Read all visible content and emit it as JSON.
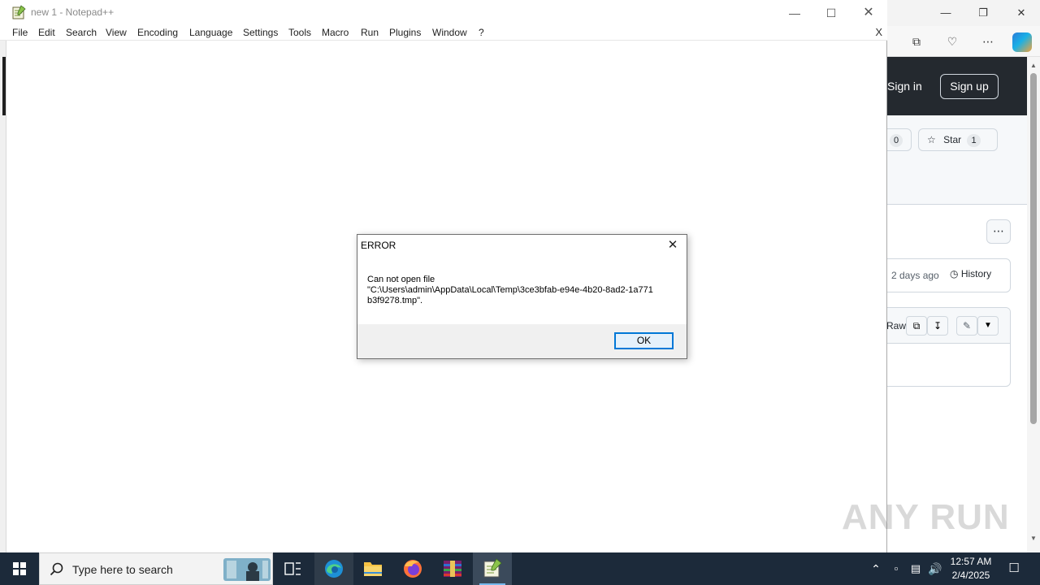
{
  "notepad": {
    "title": "new 1 - Notepad++",
    "menu": [
      "File",
      "Edit",
      "Search",
      "View",
      "Encoding",
      "Language",
      "Settings",
      "Tools",
      "Macro",
      "Run",
      "Plugins",
      "Window",
      "?"
    ],
    "menu_close": "X"
  },
  "dialog": {
    "title": "ERROR",
    "message": "Can not open file\n\"C:\\Users\\admin\\AppData\\Local\\Temp\\3ce3bfab-e94e-4b20-8ad2-1a771\nb3f9278.tmp\".",
    "ok_label": "OK"
  },
  "browser": {
    "sign_in": "Sign in",
    "sign_up": "Sign up",
    "watch_count": "0",
    "star_label": "Star",
    "star_count": "1",
    "last_commit": "2 days ago",
    "history_label": "History",
    "raw_label": "Raw"
  },
  "watermark": "ANY RUN",
  "taskbar": {
    "search_placeholder": "Type here to search",
    "time": "12:57 AM",
    "date": "2/4/2025"
  },
  "colors": {
    "accent": "#0078d7",
    "taskbar": "#1c2a3a",
    "github_header": "#24292f"
  }
}
